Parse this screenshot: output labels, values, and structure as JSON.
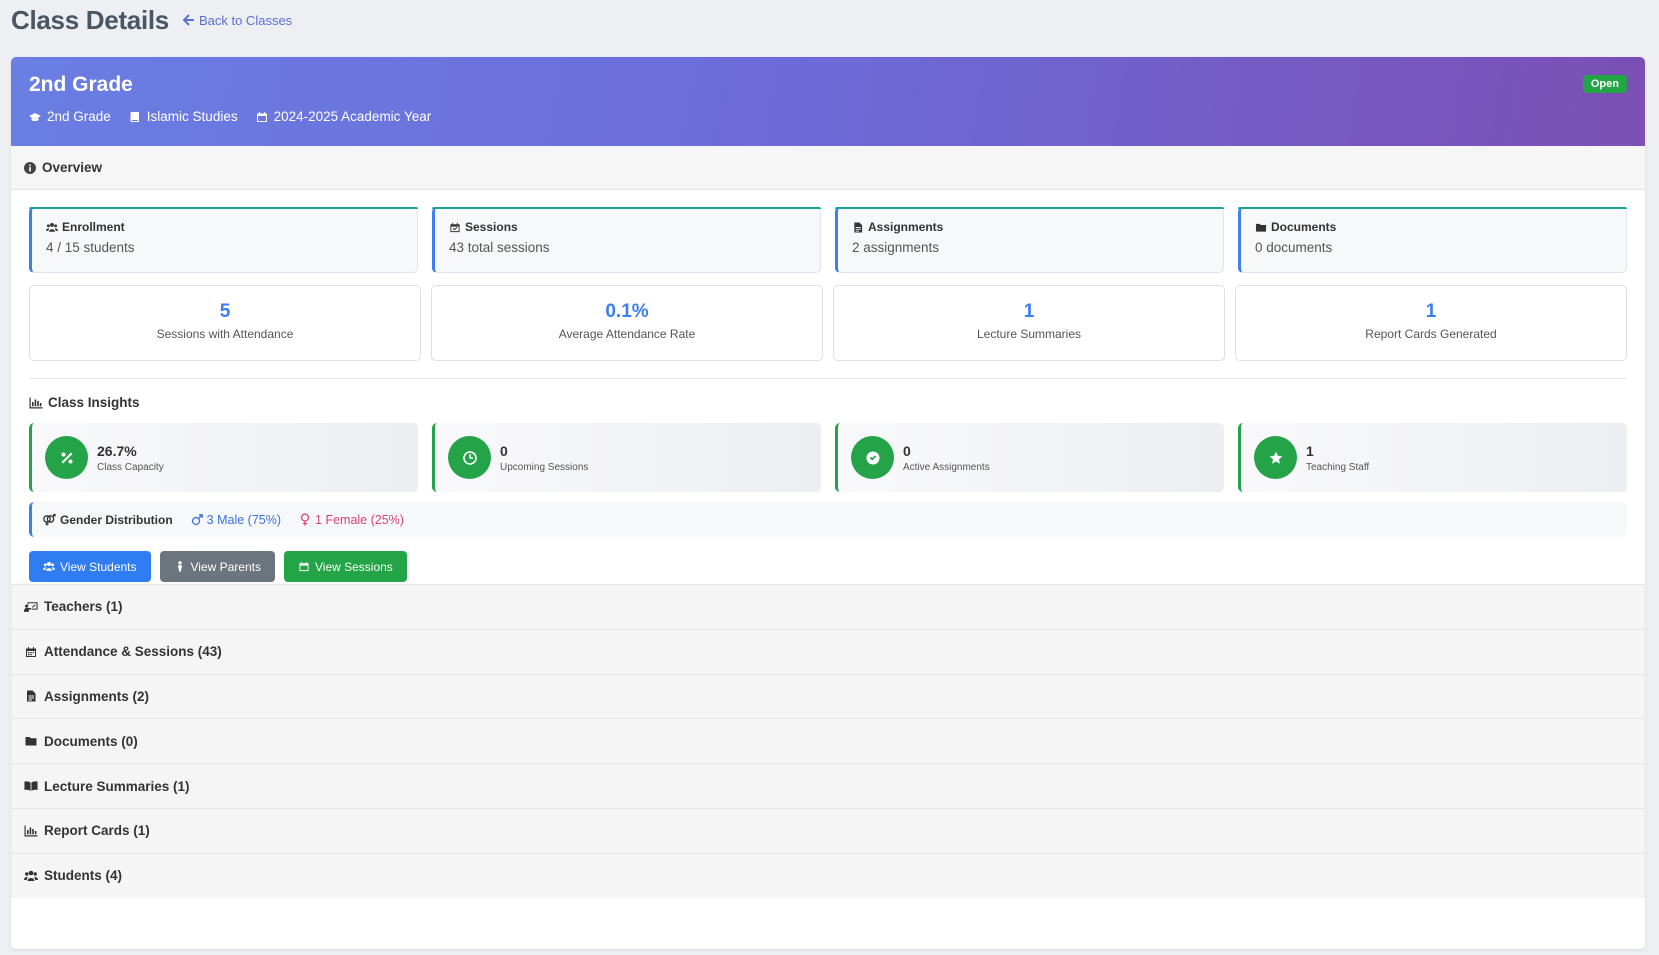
{
  "header": {
    "title": "Class Details",
    "back_label": "Back to Classes"
  },
  "hero": {
    "title": "2nd Grade",
    "grade": "2nd Grade",
    "subject": "Islamic Studies",
    "year": "2024-2025 Academic Year",
    "status": "Open"
  },
  "overview": {
    "title": "Overview",
    "stats": [
      {
        "label": "Enrollment",
        "value": "4 / 15 students"
      },
      {
        "label": "Sessions",
        "value": "43 total sessions"
      },
      {
        "label": "Assignments",
        "value": "2 assignments"
      },
      {
        "label": "Documents",
        "value": "0 documents"
      }
    ],
    "metrics": [
      {
        "value": "5",
        "label": "Sessions with Attendance"
      },
      {
        "value": "0.1%",
        "label": "Average Attendance Rate"
      },
      {
        "value": "1",
        "label": "Lecture Summaries"
      },
      {
        "value": "1",
        "label": "Report Cards Generated"
      }
    ]
  },
  "insights": {
    "title": "Class Insights",
    "cards": [
      {
        "value": "26.7%",
        "label": "Class Capacity",
        "icon": "percent-icon"
      },
      {
        "value": "0",
        "label": "Upcoming Sessions",
        "icon": "clock-icon"
      },
      {
        "value": "0",
        "label": "Active Assignments",
        "icon": "check-circle-icon"
      },
      {
        "value": "1",
        "label": "Teaching Staff",
        "icon": "star-icon"
      }
    ],
    "gender": {
      "title": "Gender Distribution",
      "male": "3 Male (75%)",
      "female": "1 Female (25%)"
    }
  },
  "buttons": {
    "students": "View Students",
    "parents": "View Parents",
    "sessions": "View Sessions"
  },
  "sections": [
    {
      "label": "Teachers (1)",
      "icon": "chalkboard-teacher-icon"
    },
    {
      "label": "Attendance & Sessions (43)",
      "icon": "calendar-icon"
    },
    {
      "label": "Assignments (2)",
      "icon": "file-icon"
    },
    {
      "label": "Documents (0)",
      "icon": "folder-icon"
    },
    {
      "label": "Lecture Summaries (1)",
      "icon": "book-open-icon"
    },
    {
      "label": "Report Cards (1)",
      "icon": "bar-chart-icon"
    },
    {
      "label": "Students (4)",
      "icon": "users-icon"
    }
  ],
  "colors": {
    "accent_blue": "#3a7ef0",
    "success_green": "#24a349",
    "secondary_gray": "#6c757d",
    "male_blue": "#3a72d8",
    "female_pink": "#d6447a",
    "hero_gradient_start": "#6a7ee3",
    "hero_gradient_end": "#7b4fb4"
  }
}
